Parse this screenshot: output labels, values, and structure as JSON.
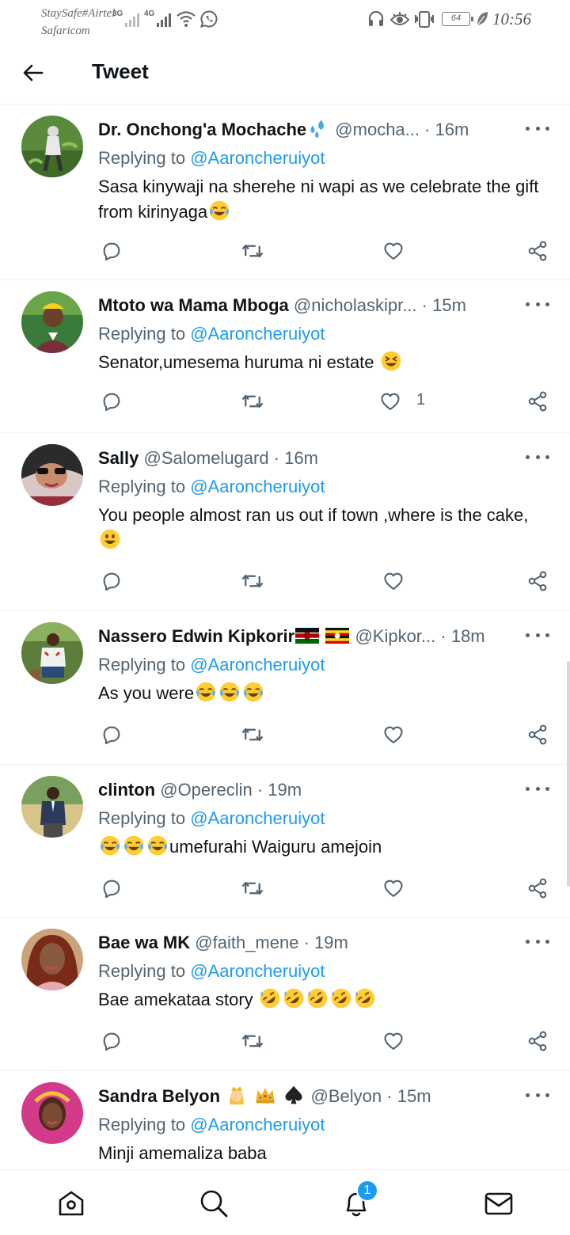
{
  "status_bar": {
    "carrier_1": "StaySafe#Airtel",
    "carrier_2": "Safaricom",
    "net_type_1": "3G",
    "net_type_2": "4G",
    "battery": "64",
    "time": "10:56",
    "icons": [
      "signal-icon",
      "wifi-icon",
      "whatsapp-icon",
      "headset-icon",
      "eye-icon",
      "vibrate-icon",
      "battery-icon",
      "leaf-icon"
    ]
  },
  "header": {
    "title": "Tweet"
  },
  "reply_prefix": "Replying to",
  "tweets": [
    {
      "name": "Dr. Onchong'a Mochache",
      "handle": "@mocha...",
      "time": "· 16m",
      "reply_to": "@Aaroncheruiyot",
      "text": "Sasa kinywaji na sherehe ni wapi as we celebrate the gift from kirinyaga",
      "emojis": [
        "face-with-tears-of-joy-emoji"
      ],
      "likes": ""
    },
    {
      "name": "Mtoto wa Mama Mboga",
      "handle": "@nicholaskipr...",
      "time": "· 15m",
      "reply_to": "@Aaroncheruiyot",
      "text": "Senator,umesema huruma ni estate",
      "emojis": [
        "grinning-squinting-face-emoji"
      ],
      "likes": "1"
    },
    {
      "name": "Sally",
      "handle": "@Salomelugard",
      "time": "· 16m",
      "reply_to": "@Aaroncheruiyot",
      "text": "You people almost ran us out if town ,where is the cake,",
      "emojis": [
        "grinning-face-emoji"
      ],
      "likes": ""
    },
    {
      "name": "Nassero Edwin Kipkorir",
      "handle": "@Kipkor...",
      "time": "· 18m",
      "reply_to": "@Aaroncheruiyot",
      "text": "As you were",
      "emojis": [
        "face-with-tears-of-joy-emoji",
        "face-with-tears-of-joy-emoji",
        "face-with-tears-of-joy-emoji"
      ],
      "name_emojis": [
        "kenya-flag",
        "uganda-flag"
      ],
      "likes": ""
    },
    {
      "name": "clinton",
      "handle": "@Opereclin",
      "time": "· 19m",
      "reply_to": "@Aaroncheruiyot",
      "text": "umefurahi Waiguru amejoin",
      "emojis": [
        "face-with-tears-of-joy-emoji",
        "face-with-tears-of-joy-emoji",
        "face-with-tears-of-joy-emoji"
      ],
      "likes": ""
    },
    {
      "name": "Bae wa MK",
      "handle": "@faith_mene",
      "time": "· 19m",
      "reply_to": "@Aaroncheruiyot",
      "text": "Bae amekataa story",
      "emojis": [
        "rolling-on-floor-laughing-emoji",
        "rolling-on-floor-laughing-emoji",
        "rolling-on-floor-laughing-emoji",
        "rolling-on-floor-laughing-emoji",
        "rolling-on-floor-laughing-emoji"
      ],
      "likes": ""
    },
    {
      "name": "Sandra Belyon",
      "handle": "@Belyon",
      "time": "· 15m",
      "reply_to": "@Aaroncheruiyot",
      "text": "Minji amemaliza baba",
      "name_emojis": [
        "princess-emoji",
        "crown-emoji",
        "spade-suit-emoji"
      ],
      "likes": ""
    }
  ],
  "bottom_nav": {
    "items": [
      "home-icon",
      "search-icon",
      "notifications-icon",
      "messages-icon"
    ],
    "notification_badge": "1"
  },
  "colors": {
    "accent": "#1d9bf0",
    "text_primary": "#0f1419",
    "text_secondary": "#536471",
    "divider": "#eff3f4"
  }
}
